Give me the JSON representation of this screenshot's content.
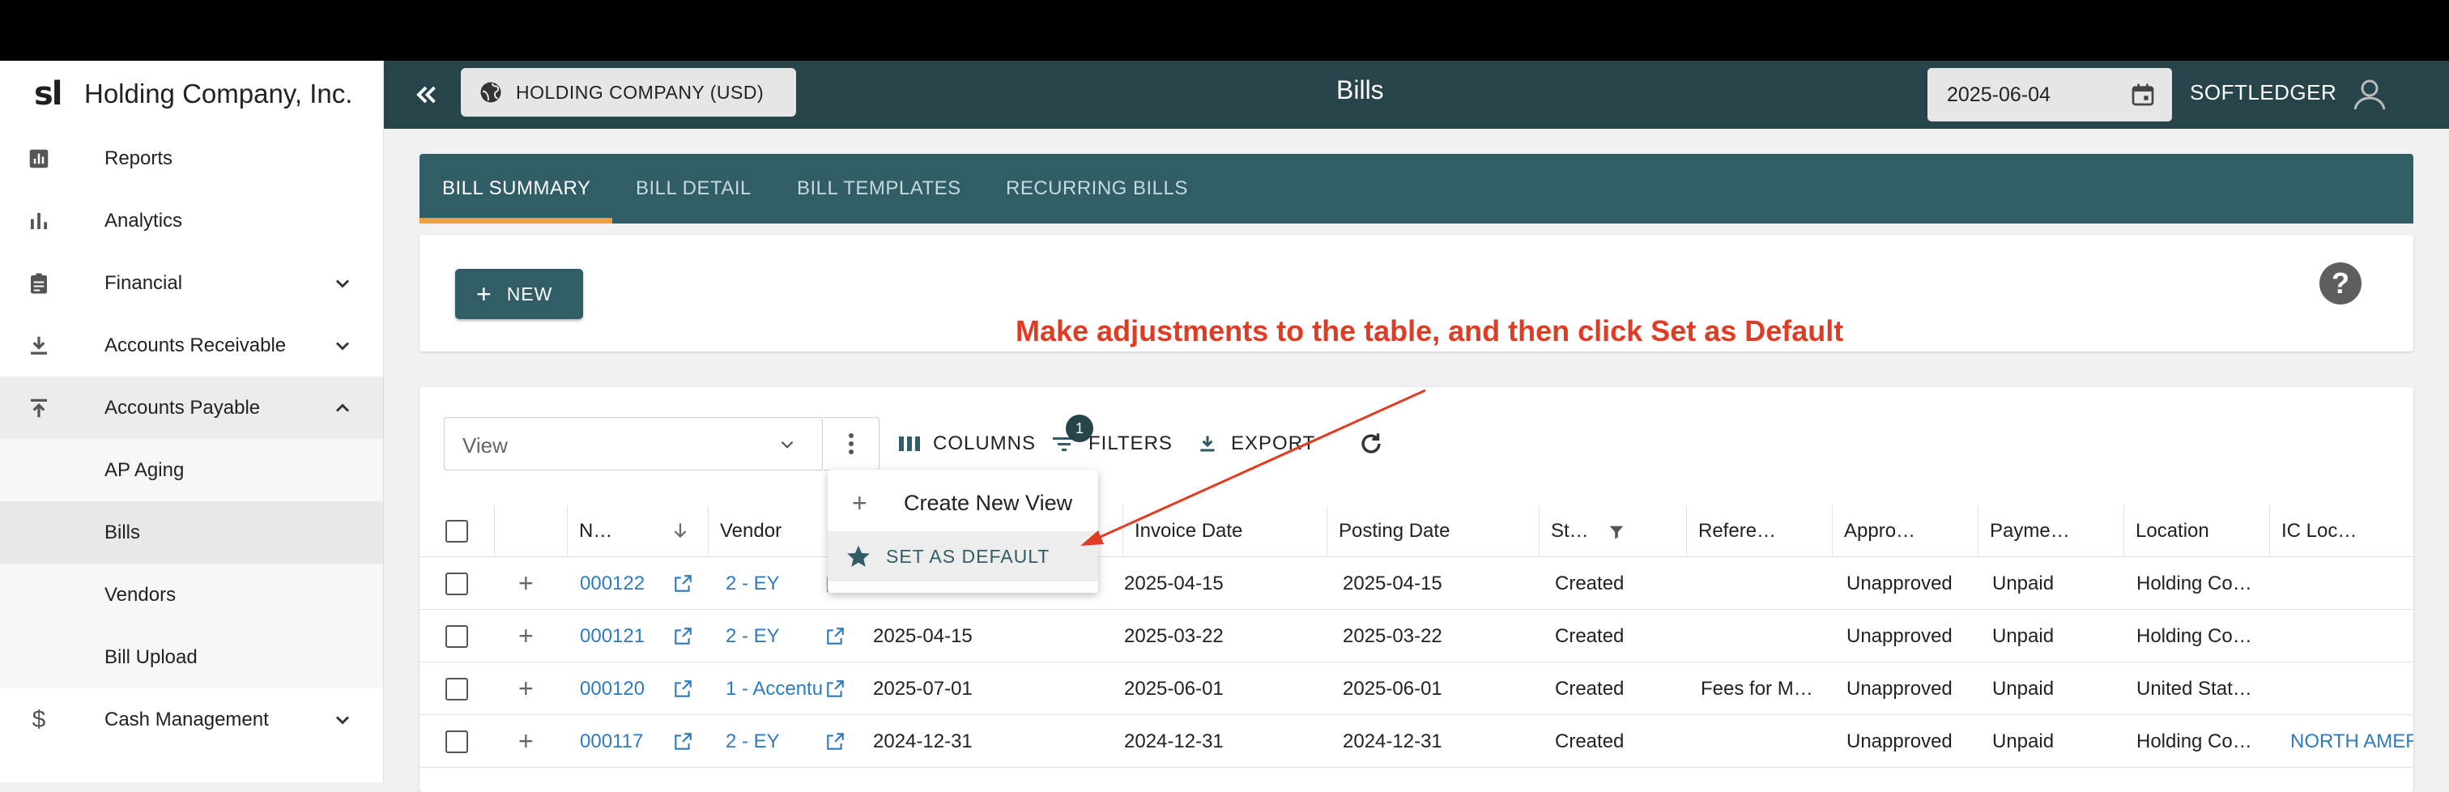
{
  "sidebar": {
    "logo": "sl",
    "company": "Holding Company, Inc.",
    "items": [
      {
        "label": "Reports",
        "icon": "report-icon"
      },
      {
        "label": "Analytics",
        "icon": "bar-chart-icon"
      },
      {
        "label": "Financial",
        "icon": "clipboard-icon"
      },
      {
        "label": "Accounts Receivable",
        "icon": "download-icon"
      },
      {
        "label": "Accounts Payable",
        "icon": "upload-icon"
      },
      {
        "label": "Cash Management",
        "icon": "dollar-icon"
      }
    ],
    "sub_items": [
      "AP Aging",
      "Bills",
      "Vendors",
      "Bill Upload"
    ]
  },
  "header": {
    "entity": "HOLDING COMPANY (USD)",
    "title": "Bills",
    "date": "2025-06-04",
    "user": "SOFTLEDGER"
  },
  "tabs": [
    "BILL SUMMARY",
    "BILL DETAIL",
    "BILL TEMPLATES",
    "RECURRING BILLS"
  ],
  "new_button": "NEW",
  "help": "?",
  "annotation": "Make adjustments to the table, and then click Set as Default",
  "toolbar": {
    "view_placeholder": "View",
    "columns": "COLUMNS",
    "filters": "FILTERS",
    "filters_count": "1",
    "export": "EXPORT"
  },
  "menu": {
    "create_new_view": "Create New View",
    "set_as_default": "SET AS DEFAULT"
  },
  "table": {
    "headers": [
      "N…",
      "Vendor",
      "Invoice Date",
      "Posting Date",
      "St…",
      "Refere…",
      "Appro…",
      "Payme…",
      "Location",
      "IC Loc…"
    ],
    "rows": [
      {
        "number": "000122",
        "vendor": "2 - EY",
        "date": "",
        "invoice_date": "2025-04-15",
        "posting_date": "2025-04-15",
        "status": "Created",
        "reference": "",
        "approval": "Unapproved",
        "payment": "Unpaid",
        "location": "Holding Co…",
        "ic_location": ""
      },
      {
        "number": "000121",
        "vendor": "2 - EY",
        "date": "2025-04-15",
        "invoice_date": "2025-03-22",
        "posting_date": "2025-03-22",
        "status": "Created",
        "reference": "",
        "approval": "Unapproved",
        "payment": "Unpaid",
        "location": "Holding Co…",
        "ic_location": ""
      },
      {
        "number": "000120",
        "vendor": "1 - Accentu",
        "date": "2025-07-01",
        "invoice_date": "2025-06-01",
        "posting_date": "2025-06-01",
        "status": "Created",
        "reference": "Fees for M…",
        "approval": "Unapproved",
        "payment": "Unpaid",
        "location": "United Stat…",
        "ic_location": ""
      },
      {
        "number": "000117",
        "vendor": "2 - EY",
        "date": "2024-12-31",
        "invoice_date": "2024-12-31",
        "posting_date": "2024-12-31",
        "status": "Created",
        "reference": "",
        "approval": "Unapproved",
        "payment": "Unpaid",
        "location": "Holding Co…",
        "ic_location": "NORTH AMER"
      }
    ]
  },
  "colors": {
    "header_bg": "#28444b",
    "tabs_bg": "#305d66",
    "tab_indicator": "#e8a33d",
    "annotation": "#e03c23",
    "link": "#2f7bbd"
  }
}
